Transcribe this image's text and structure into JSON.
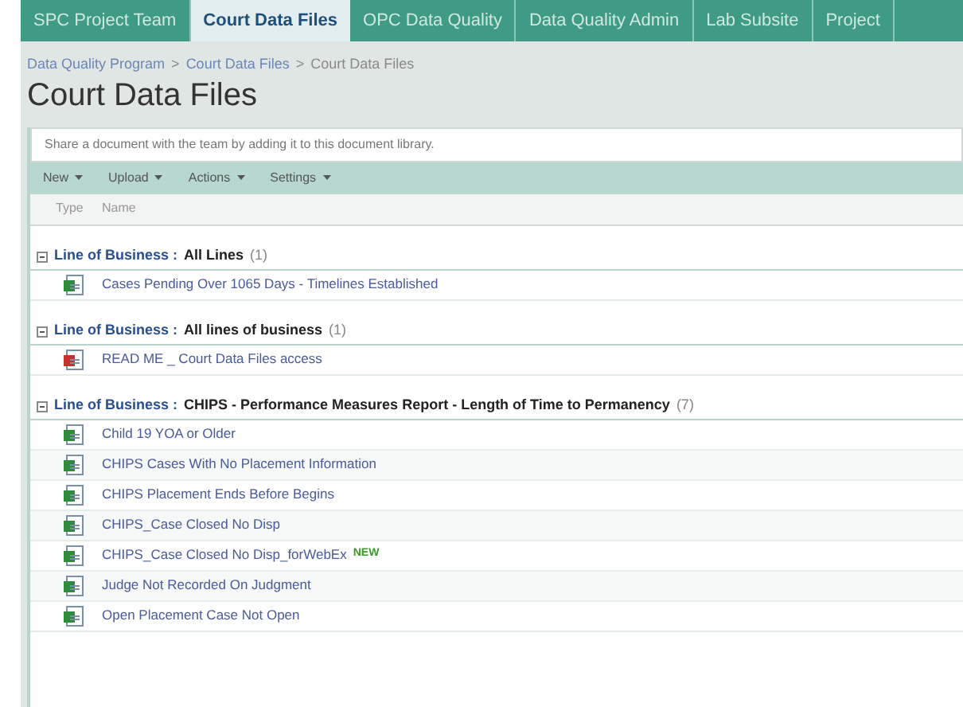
{
  "tabs": [
    {
      "label": "SPC Project Team",
      "selected": false
    },
    {
      "label": "Court Data Files",
      "selected": true
    },
    {
      "label": "OPC Data Quality",
      "selected": false
    },
    {
      "label": "Data Quality Admin",
      "selected": false
    },
    {
      "label": "Lab Subsite",
      "selected": false
    },
    {
      "label": "Project",
      "selected": false
    }
  ],
  "breadcrumb": [
    {
      "label": "Data Quality Program",
      "link": true
    },
    {
      "label": ">",
      "link": false
    },
    {
      "label": "Court Data Files",
      "link": true
    },
    {
      "label": ">",
      "link": false
    },
    {
      "label": "Court Data Files",
      "link": false
    }
  ],
  "page_title": "Court Data Files",
  "description": "Share a document with the team by adding it to this document library.",
  "toolbar": [
    "New",
    "Upload",
    "Actions",
    "Settings"
  ],
  "columns": [
    "Type",
    "Name"
  ],
  "groups": [
    {
      "field": "Line of Business :",
      "value": "All Lines",
      "count": "(1)",
      "expanded": true,
      "items": [
        {
          "kind": "excel",
          "name": "Cases Pending Over 1065 Days - Timelines Established",
          "new": false
        }
      ]
    },
    {
      "field": "Line of Business :",
      "value": "All lines of business",
      "count": "(1)",
      "expanded": true,
      "items": [
        {
          "kind": "pdf",
          "name": "READ ME _ Court Data Files access",
          "new": false
        }
      ]
    },
    {
      "field": "Line of Business :",
      "value": "CHIPS - Performance Measures Report - Length of Time to Permanency",
      "count": "(7)",
      "expanded": true,
      "items": [
        {
          "kind": "excel",
          "name": "Child 19 YOA or Older",
          "new": false
        },
        {
          "kind": "excel",
          "name": "CHIPS Cases With No Placement Information",
          "new": false
        },
        {
          "kind": "excel",
          "name": "CHIPS Placement Ends Before Begins",
          "new": false
        },
        {
          "kind": "excel",
          "name": "CHIPS_Case Closed No Disp",
          "new": false
        },
        {
          "kind": "excel",
          "name": "CHIPS_Case Closed No Disp_forWebEx",
          "new": true,
          "new_label": "NEW"
        },
        {
          "kind": "excel",
          "name": "Judge Not Recorded On Judgment",
          "new": false
        },
        {
          "kind": "excel",
          "name": "Open Placement Case Not Open",
          "new": false
        }
      ]
    }
  ]
}
